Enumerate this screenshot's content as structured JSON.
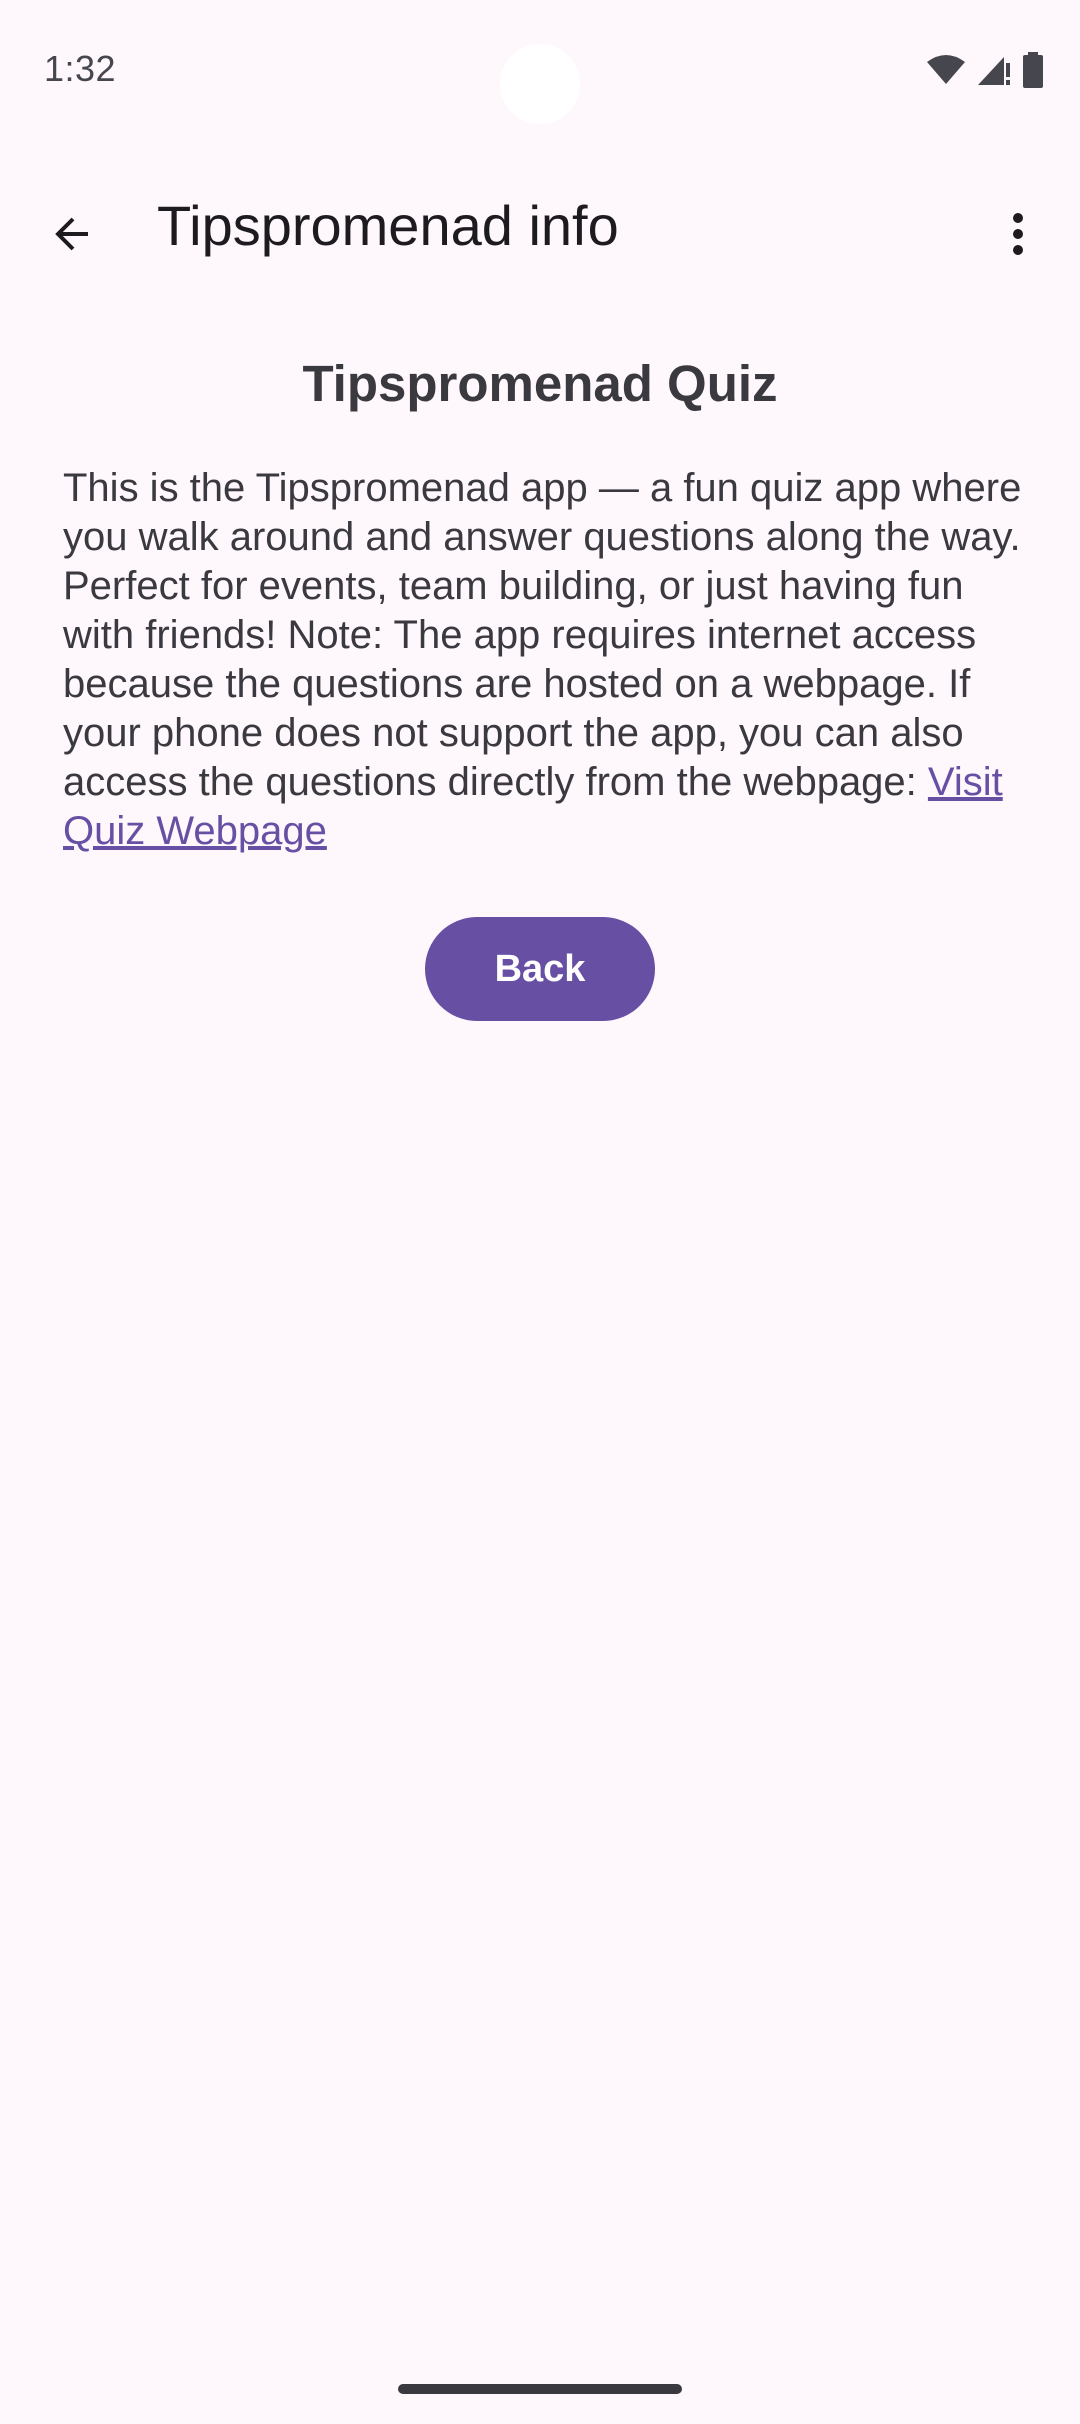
{
  "status_bar": {
    "time": "1:32",
    "icons": [
      "wifi-icon",
      "cell-signal-icon",
      "battery-icon"
    ]
  },
  "app_bar": {
    "title": "Tipspromenad info",
    "navigation_icon": "arrow-back-icon",
    "menu_icon": "more-vert-icon"
  },
  "main": {
    "heading": "Tipspromenad Quiz",
    "description": "This is the Tipspromenad app — a fun quiz app where you walk around and answer questions along the way. Perfect for events, team building, or just having fun with friends! Note: The app requires internet access because the questions are hosted on a webpage. If your phone does not support the app, you can also access the questions directly from the webpage: ",
    "link_text": "Visit Quiz Webpage",
    "back_button_label": "Back"
  },
  "colors": {
    "background": "#FEF7FC",
    "primary": "#6750A4",
    "on_primary": "#FFFFFF",
    "text": "#3A3940"
  }
}
